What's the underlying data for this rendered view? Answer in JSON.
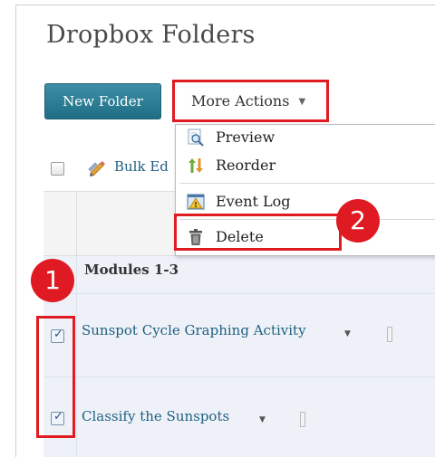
{
  "page": {
    "title": "Dropbox Folders"
  },
  "toolbar": {
    "new_folder_label": "New Folder",
    "more_actions_label": "More Actions",
    "more_actions_caret": "▼",
    "bulk_edit_label": "Bulk Ed"
  },
  "dropdown": {
    "items": [
      {
        "label": "Preview",
        "icon": "preview-icon"
      },
      {
        "label": "Reorder",
        "icon": "reorder-icon"
      },
      {
        "label": "Event Log",
        "icon": "event-log-icon"
      },
      {
        "label": "Delete",
        "icon": "trash-icon"
      }
    ]
  },
  "grid": {
    "section_label": "Modules 1-3",
    "rows": [
      {
        "name": "Sunspot Cycle Graphing Activity",
        "checked": true,
        "caret": "▼"
      },
      {
        "name": "Classify the Sunspots",
        "checked": true,
        "caret": "▼"
      }
    ]
  },
  "annotations": {
    "badge_1": "1",
    "badge_2": "2",
    "highlight_color": "#e11b22"
  },
  "colors": {
    "primary_button": "#2a7d96",
    "link": "#1f5f82",
    "row_background": "#eef2f8"
  }
}
